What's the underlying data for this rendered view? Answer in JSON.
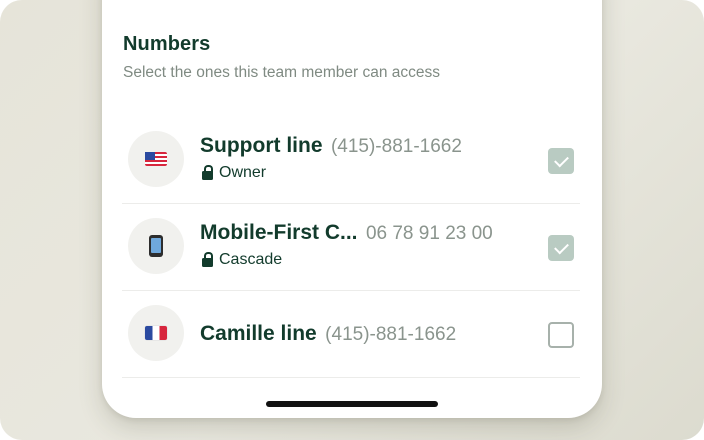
{
  "section": {
    "title": "Numbers",
    "subtitle": "Select the ones this team member can access"
  },
  "numbers": [
    {
      "name": "Support line",
      "number": "(415)-881-1662",
      "access": "Owner",
      "icon": "us-flag-icon",
      "checked": true
    },
    {
      "name": "Mobile-First C...",
      "number": "06 78 91 23 00",
      "access": "Cascade",
      "icon": "mobile-phone-icon",
      "checked": true
    },
    {
      "name": "Camille line",
      "number": "(415)-881-1662",
      "access": "",
      "icon": "fr-flag-icon",
      "checked": false
    }
  ],
  "colors": {
    "title": "#123b2c",
    "checked_box": "#b9cbc2",
    "unchecked_border": "#a7b1ab"
  }
}
